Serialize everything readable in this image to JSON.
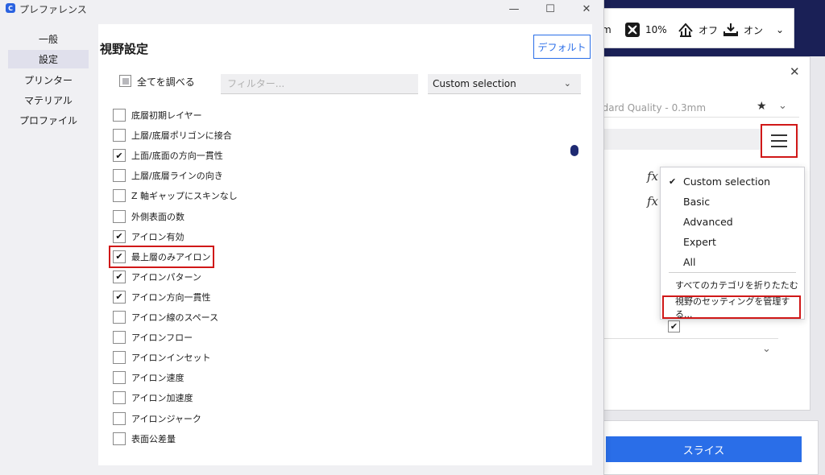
{
  "window": {
    "title": "プレファレンス",
    "minimize": "—",
    "maximize": "☐",
    "close": "✕"
  },
  "nav": [
    {
      "label": "一般"
    },
    {
      "label": "設定"
    },
    {
      "label": "プリンター"
    },
    {
      "label": "マテリアル"
    },
    {
      "label": "プロファイル"
    }
  ],
  "page": {
    "title": "視野設定",
    "default_button": "デフォルト",
    "check_all_label": "全てを調べる",
    "filter_placeholder": "フィルター...",
    "selection": "Custom selection"
  },
  "settings": [
    {
      "label": "底層初期レイヤー",
      "checked": false
    },
    {
      "label": "上層/底層ポリゴンに接合",
      "checked": false
    },
    {
      "label": "上面/底面の方向一貫性",
      "checked": true
    },
    {
      "label": "上層/底層ラインの向き",
      "checked": false
    },
    {
      "label": "Z 軸ギャップにスキンなし",
      "checked": false
    },
    {
      "label": "外側表面の数",
      "checked": false
    },
    {
      "label": "アイロン有効",
      "checked": true
    },
    {
      "label": "最上層のみアイロン",
      "checked": true
    },
    {
      "label": "アイロンパターン",
      "checked": true
    },
    {
      "label": "アイロン方向一貫性",
      "checked": true
    },
    {
      "label": "アイロン線のスペース",
      "checked": false
    },
    {
      "label": "アイロンフロー",
      "checked": false
    },
    {
      "label": "アイロンインセット",
      "checked": false
    },
    {
      "label": "アイロン速度",
      "checked": false
    },
    {
      "label": "アイロン加速度",
      "checked": false
    },
    {
      "label": "アイロンジャーク",
      "checked": false
    },
    {
      "label": "表面公差量",
      "checked": false
    }
  ],
  "background": {
    "header": {
      "layer_suffix": "m",
      "infill_value": "10%",
      "support_value": "オフ",
      "adhesion_value": "オン"
    },
    "profile_text": "ndard Quality - 0.3mm",
    "fx_symbol": "fx",
    "slice_button": "スライス"
  },
  "menu": {
    "items": [
      {
        "label": "Custom selection",
        "checked": true
      },
      {
        "label": "Basic",
        "checked": false
      },
      {
        "label": "Advanced",
        "checked": false
      },
      {
        "label": "Expert",
        "checked": false
      },
      {
        "label": "All",
        "checked": false
      }
    ],
    "collapse_all": "すべてのカテゴリを折りたたむ",
    "manage_visibility": "視野のセッティングを管理する..."
  },
  "colors": {
    "accent": "#2a6ee8",
    "highlight": "#d01818",
    "topbar": "#1a2056"
  }
}
